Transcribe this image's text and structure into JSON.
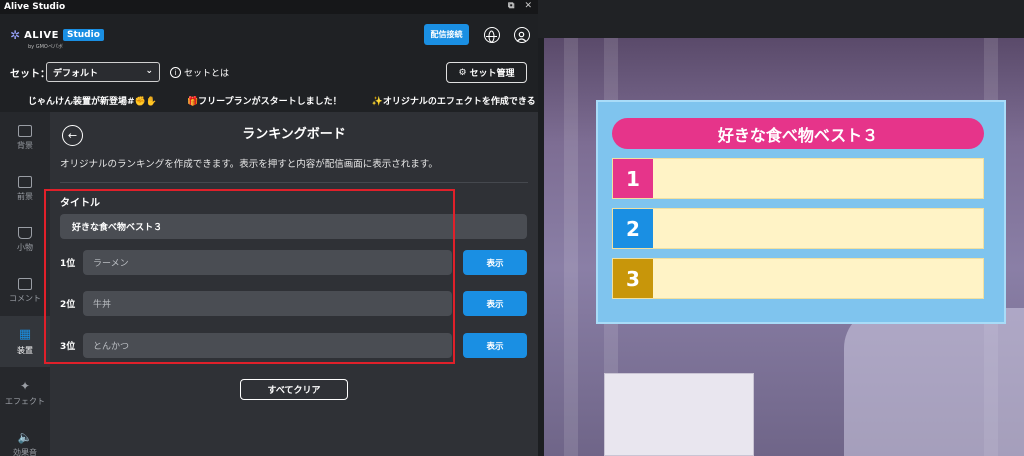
{
  "window": {
    "title": "Alive Studio"
  },
  "header": {
    "logo_text": "ALIVE",
    "logo_badge": "Studio",
    "logo_sub": "by GMOペパボ",
    "stream_button": "配信接続"
  },
  "set_bar": {
    "label": "セット：",
    "selected": "デフォルト",
    "help_text": "セットとは",
    "manage_button": "セット管理"
  },
  "ticker": [
    "じゃんけん装置が新登場#✊✋",
    "🎁フリープランがスタートしました！",
    "✨オリジナルのエフェクトを作成できる"
  ],
  "sidebar": {
    "items": [
      {
        "label": "背景"
      },
      {
        "label": "前景"
      },
      {
        "label": "小物"
      },
      {
        "label": "コメント"
      },
      {
        "label": "装置"
      },
      {
        "label": "エフェクト"
      },
      {
        "label": "効果音"
      }
    ]
  },
  "main": {
    "page_title": "ランキングボード",
    "description": "オリジナルのランキングを作成できます。表示を押すと内容が配信画面に表示されます。",
    "section_title": "タイトル",
    "title_value": "好きな食べ物ベスト３",
    "ranks": [
      {
        "label": "1位",
        "value": "ラーメン",
        "button": "表示"
      },
      {
        "label": "2位",
        "value": "牛丼",
        "button": "表示"
      },
      {
        "label": "3位",
        "value": "とんかつ",
        "button": "表示"
      }
    ],
    "clear_button": "すべてクリア"
  },
  "preview": {
    "board_title": "好きな食べ物ベスト３",
    "numbers": [
      "1",
      "2",
      "3"
    ],
    "number_colors": [
      "#e6348a",
      "#1a8fe3",
      "#c8960a"
    ]
  }
}
